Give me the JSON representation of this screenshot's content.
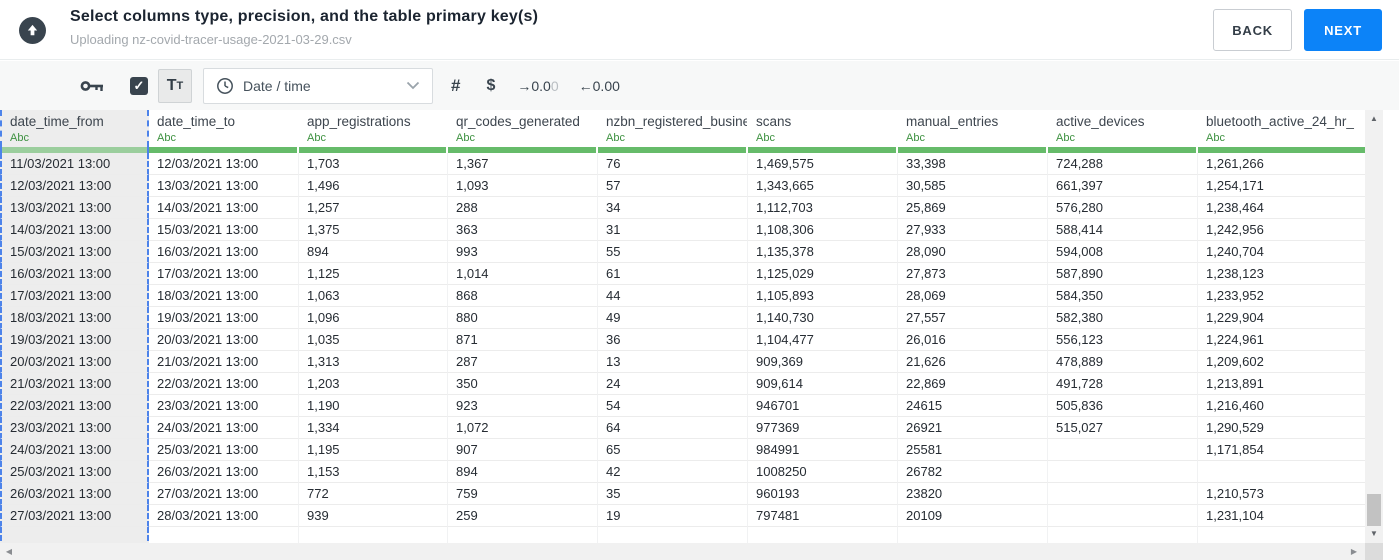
{
  "header": {
    "title": "Select columns type, precision, and the table primary key(s)",
    "subtitle": "Uploading nz-covid-tracer-usage-2021-03-29.csv",
    "back_label": "BACK",
    "next_label": "NEXT"
  },
  "toolbar": {
    "key_icon": "primary-key-icon",
    "checkbox_checked": true,
    "check_glyph": "✓",
    "text_button": {
      "big": "T",
      "small": "T"
    },
    "type_dropdown": {
      "icon": "clock-icon",
      "value": "Date / time"
    },
    "number_label": "#",
    "currency_label": "$",
    "precision_out": {
      "arrow": "→",
      "value": "0.0",
      "faded": "0"
    },
    "precision_in": {
      "arrow": "←",
      "value": "0.00",
      "faded": ""
    }
  },
  "table": {
    "type_badge": "Abc",
    "selected_index": 0,
    "selected_column": "date_time_from",
    "columns": [
      "date_time_from",
      "date_time_to",
      "app_registrations",
      "qr_codes_generated",
      "nzbn_registered_busine",
      "scans",
      "manual_entries",
      "active_devices",
      "bluetooth_active_24_hr_"
    ],
    "rows": [
      [
        "11/03/2021 13:00",
        "12/03/2021 13:00",
        "1,703",
        "1,367",
        "76",
        "1,469,575",
        "33,398",
        "724,288",
        "1,261,266"
      ],
      [
        "12/03/2021 13:00",
        "13/03/2021 13:00",
        "1,496",
        "1,093",
        "57",
        "1,343,665",
        "30,585",
        "661,397",
        "1,254,171"
      ],
      [
        "13/03/2021 13:00",
        "14/03/2021 13:00",
        "1,257",
        "288",
        "34",
        "1,112,703",
        "25,869",
        "576,280",
        "1,238,464"
      ],
      [
        "14/03/2021 13:00",
        "15/03/2021 13:00",
        "1,375",
        "363",
        "31",
        "1,108,306",
        "27,933",
        "588,414",
        "1,242,956"
      ],
      [
        "15/03/2021 13:00",
        "16/03/2021 13:00",
        "894",
        "993",
        "55",
        "1,135,378",
        "28,090",
        "594,008",
        "1,240,704"
      ],
      [
        "16/03/2021 13:00",
        "17/03/2021 13:00",
        "1,125",
        "1,014",
        "61",
        "1,125,029",
        "27,873",
        "587,890",
        "1,238,123"
      ],
      [
        "17/03/2021 13:00",
        "18/03/2021 13:00",
        "1,063",
        "868",
        "44",
        "1,105,893",
        "28,069",
        "584,350",
        "1,233,952"
      ],
      [
        "18/03/2021 13:00",
        "19/03/2021 13:00",
        "1,096",
        "880",
        "49",
        "1,140,730",
        "27,557",
        "582,380",
        "1,229,904"
      ],
      [
        "19/03/2021 13:00",
        "20/03/2021 13:00",
        "1,035",
        "871",
        "36",
        "1,104,477",
        "26,016",
        "556,123",
        "1,224,961"
      ],
      [
        "20/03/2021 13:00",
        "21/03/2021 13:00",
        "1,313",
        "287",
        "13",
        "909,369",
        "21,626",
        "478,889",
        "1,209,602"
      ],
      [
        "21/03/2021 13:00",
        "22/03/2021 13:00",
        "1,203",
        "350",
        "24",
        "909,614",
        "22,869",
        "491,728",
        "1,213,891"
      ],
      [
        "22/03/2021 13:00",
        "23/03/2021 13:00",
        "1,190",
        "923",
        "54",
        "946701",
        "24615",
        "505,836",
        "1,216,460"
      ],
      [
        "23/03/2021 13:00",
        "24/03/2021 13:00",
        "1,334",
        "1,072",
        "64",
        "977369",
        "26921",
        "515,027",
        "1,290,529"
      ],
      [
        "24/03/2021 13:00",
        "25/03/2021 13:00",
        "1,195",
        "907",
        "65",
        "984991",
        "25581",
        "",
        "1,171,854"
      ],
      [
        "25/03/2021 13:00",
        "26/03/2021 13:00",
        "1,153",
        "894",
        "42",
        "1008250",
        "26782",
        "",
        ""
      ],
      [
        "26/03/2021 13:00",
        "27/03/2021 13:00",
        "772",
        "759",
        "35",
        "960193",
        "23820",
        "",
        "1,210,573"
      ],
      [
        "27/03/2021 13:00",
        "28/03/2021 13:00",
        "939",
        "259",
        "19",
        "797481",
        "20109",
        "",
        "1,231,104"
      ]
    ]
  },
  "scrollbars": {
    "up_arrow": "▲",
    "down_arrow": "▼",
    "left_arrow": "◀",
    "right_arrow": "▶"
  },
  "colors": {
    "accent": "#0c83f8",
    "green": "#66bb6a",
    "green-sel": "#9bce9d",
    "green-text": "#3d9140",
    "dash": "#4d83ea"
  }
}
